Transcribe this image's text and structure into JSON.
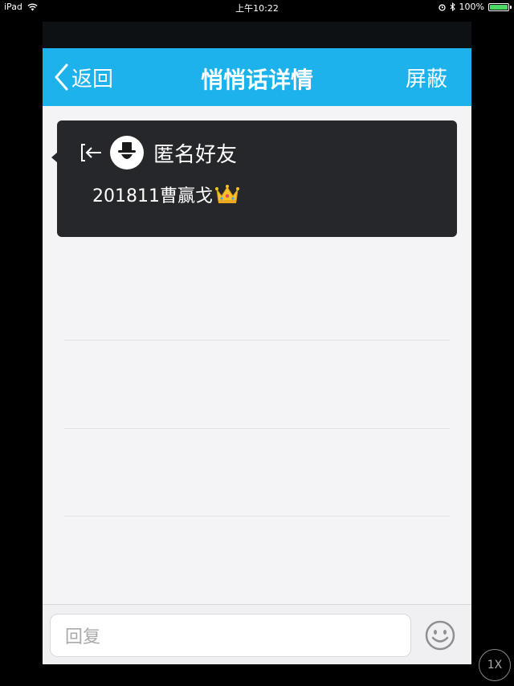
{
  "status_bar": {
    "device": "iPad",
    "time": "上午10:22",
    "battery": "100%"
  },
  "navbar": {
    "back_label": "返回",
    "title": "悄悄话详情",
    "right_label": "屏蔽"
  },
  "card": {
    "name": "匿名好友",
    "message": "201811曹赢戈"
  },
  "reply": {
    "placeholder": "回复"
  },
  "zoom": "1X",
  "colors": {
    "navbar": "#1db2ec",
    "card": "#26272b",
    "background": "#f4f4f7"
  }
}
